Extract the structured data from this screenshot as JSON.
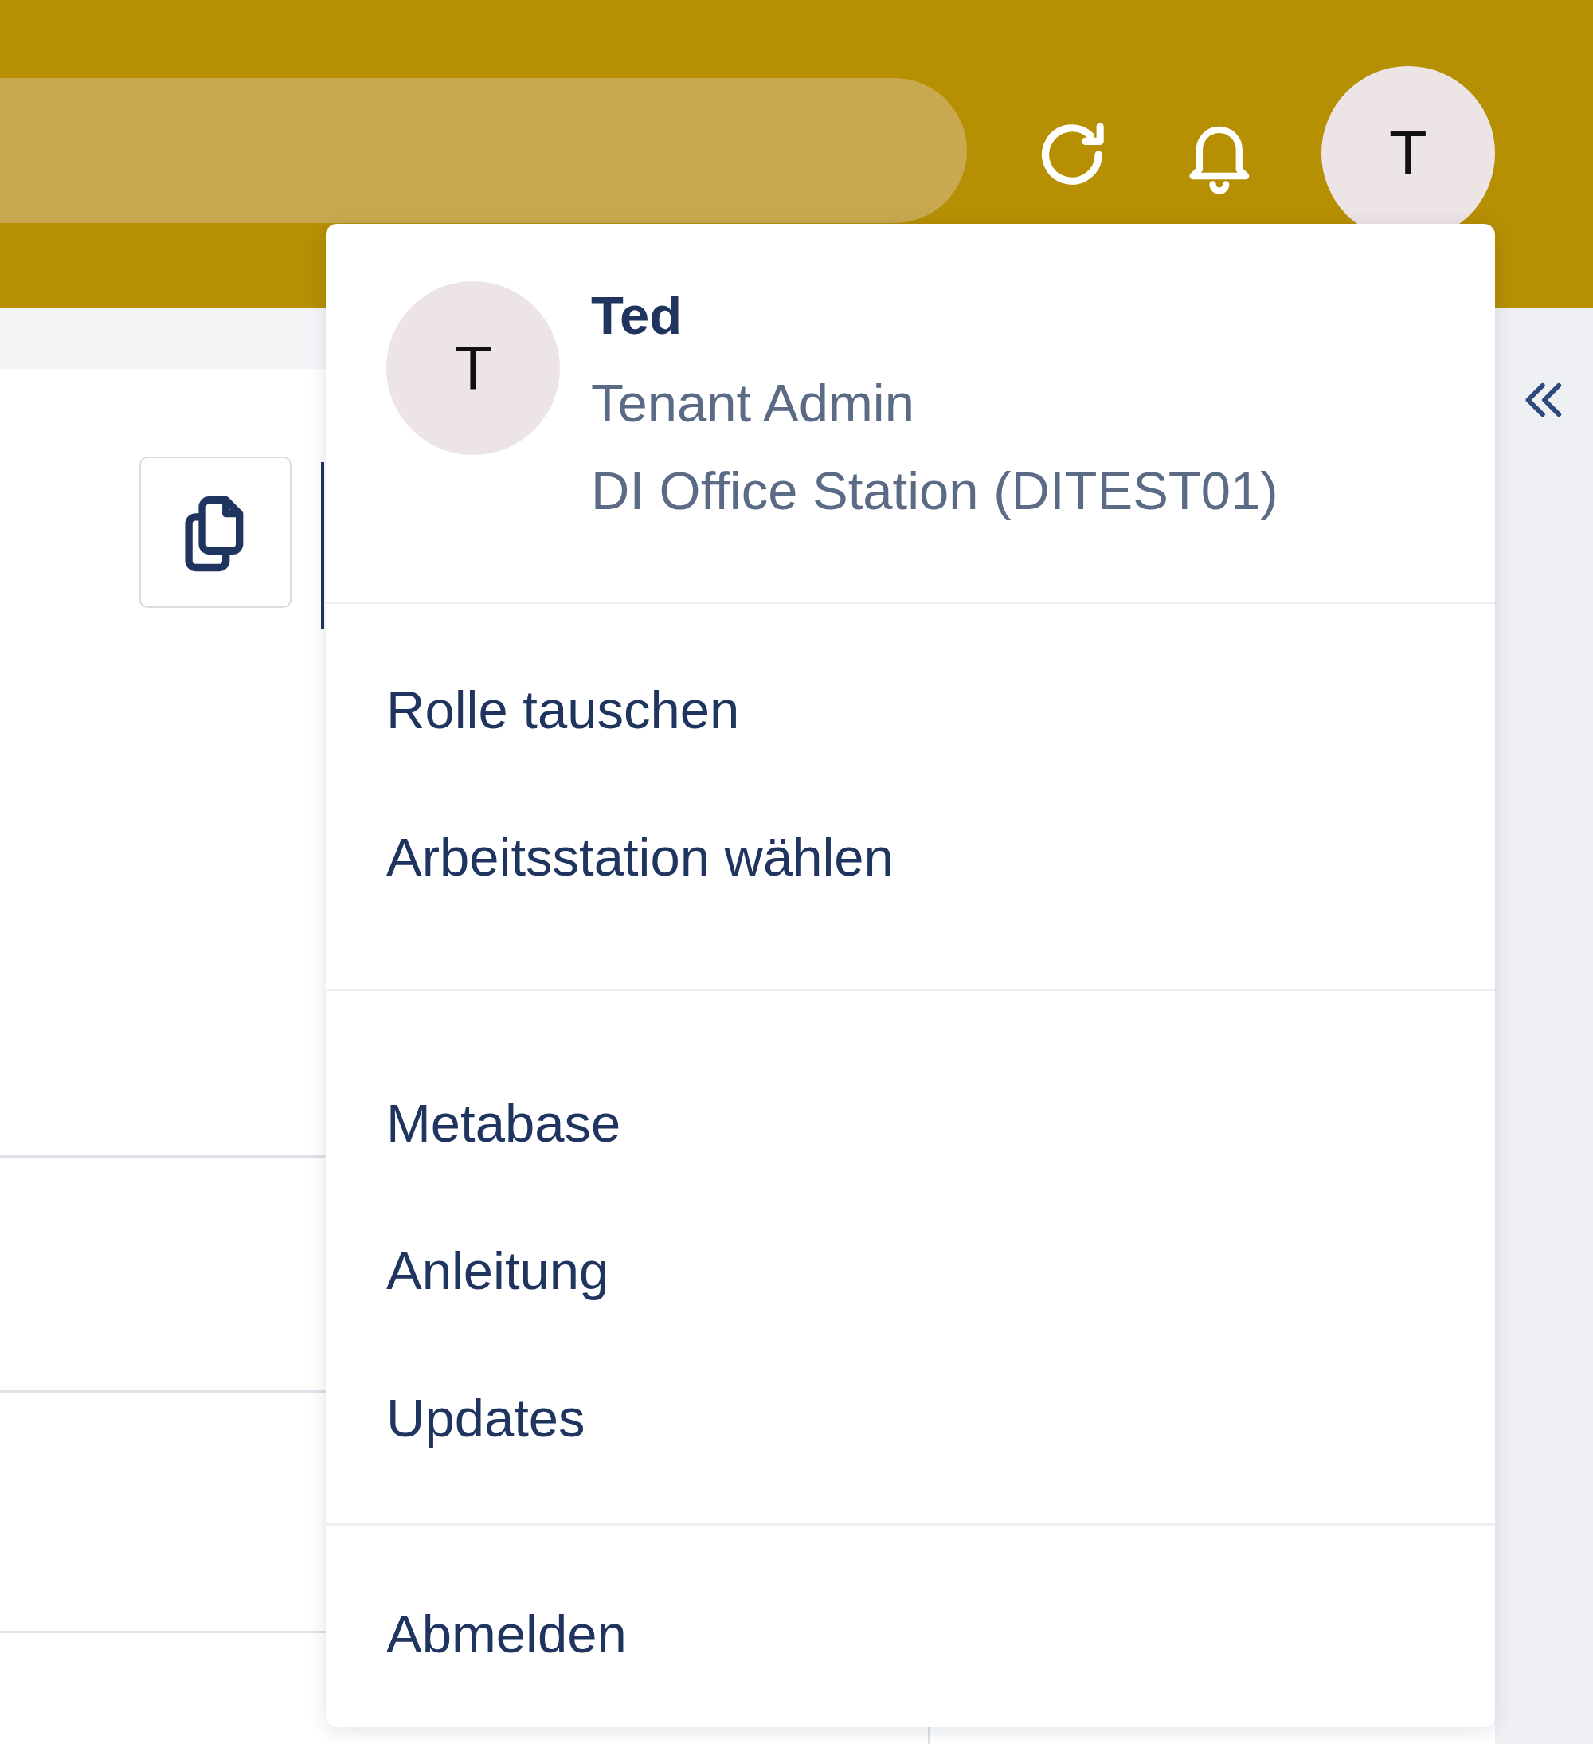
{
  "top_bar": {
    "avatar": "T"
  },
  "user_menu": {
    "avatar": "T",
    "name": "Ted",
    "role": "Tenant Admin",
    "station": "DI Office Station (DITEST01)",
    "sections": [
      {
        "items": [
          "Rolle tauschen",
          "Arbeitsstation wählen"
        ]
      },
      {
        "items": [
          "Metabase",
          "Anleitung",
          "Updates"
        ]
      },
      {
        "items": [
          "Abmelden"
        ]
      }
    ]
  }
}
